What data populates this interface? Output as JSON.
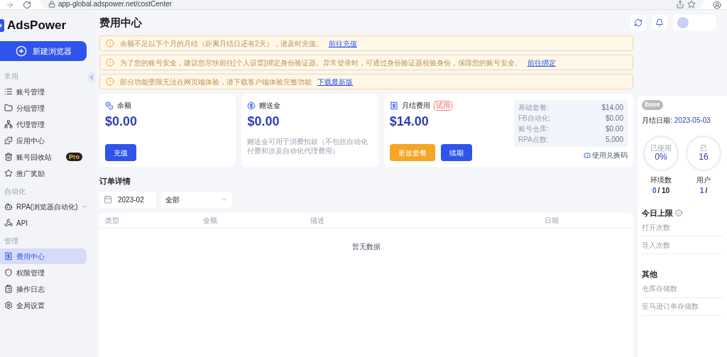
{
  "browser": {
    "url": "app-global.adspower.net/costCenter"
  },
  "sidebar": {
    "logo": "AdsPower",
    "new_button": "新建浏览器",
    "sections": [
      {
        "title": "常用",
        "items": [
          {
            "label": "账号管理",
            "selected": false
          },
          {
            "label": "分组管理",
            "selected": false
          },
          {
            "label": "代理管理",
            "selected": false
          },
          {
            "label": "应用中心",
            "selected": false
          },
          {
            "label": "账号回收站",
            "selected": false,
            "badge": "Pro"
          },
          {
            "label": "推广奖励",
            "selected": false
          }
        ]
      },
      {
        "title": "自动化",
        "items": [
          {
            "label": "RPA(浏览器自动化)",
            "selected": false,
            "expandable": true
          },
          {
            "label": "API",
            "selected": false
          }
        ]
      },
      {
        "title": "管理",
        "items": [
          {
            "label": "费用中心",
            "selected": true
          },
          {
            "label": "权限管理",
            "selected": false
          },
          {
            "label": "操作日志",
            "selected": false
          },
          {
            "label": "全局设置",
            "selected": false
          }
        ]
      }
    ]
  },
  "page_title": "费用中心",
  "alerts": [
    {
      "text": "余额不足以下个月的月结（距离月结日还有2天），请及时充值。",
      "link": "前往充值"
    },
    {
      "text": "为了您的账号安全，建议您尽快前往[个人设置]绑定身份验证器。异常登录时，可通过身份验证器校验身份，保障您的账号安全。",
      "link": "前往绑定"
    },
    {
      "text": "部分功能受限无法在网页端体验，请下载客户端体验完整功能",
      "link": "下载最新版"
    }
  ],
  "cards": [
    {
      "kind": "balance",
      "label": "余额",
      "amount": "$0.00",
      "buttons": [
        {
          "label": "充值",
          "color": "#2f54eb"
        }
      ]
    },
    {
      "kind": "gift",
      "label": "赠送金",
      "amount": "$0.00",
      "note": "赠送金可用于消费扣款（不包括自动化付费和涉及自动化代理费用）"
    },
    {
      "kind": "monthly",
      "label": "月结费用",
      "tag": "试用",
      "amount": "$14.00",
      "buttons": [
        {
          "label": "更改套餐",
          "color": "#f5a623"
        },
        {
          "label": "续期",
          "color": "#2f54eb"
        }
      ],
      "breakdown": [
        {
          "name": "基础套餐:",
          "value": "$14.00"
        },
        {
          "name": "FB自动化:",
          "value": "$0.00"
        },
        {
          "name": "账号仓库:",
          "value": "$0.00"
        },
        {
          "name": "RPA点数:",
          "value": "5,000"
        }
      ],
      "redeem": "使用兑换码"
    }
  ],
  "orders": {
    "title": "订单详情",
    "month": "2023-02",
    "filter": "全部",
    "columns": [
      "类型",
      "金额",
      "描述",
      "日期"
    ],
    "empty": "暂无数据"
  },
  "plan": {
    "badge": "Base",
    "date_label": "月结日期:",
    "date": "2023-05-03",
    "meters": [
      {
        "caption": "已使用",
        "percent": "0%",
        "name": "环境数",
        "used": "0",
        "total": "/ 10"
      },
      {
        "caption": "已",
        "percent": "16",
        "name": "用户",
        "used": "1",
        "total": "/"
      }
    ],
    "limits_title": "今日上限",
    "limits": [
      "打开次数",
      "导入次数"
    ],
    "other_title": "其他",
    "other": [
      "仓库存储数",
      "亚马逊订单存储数"
    ]
  }
}
